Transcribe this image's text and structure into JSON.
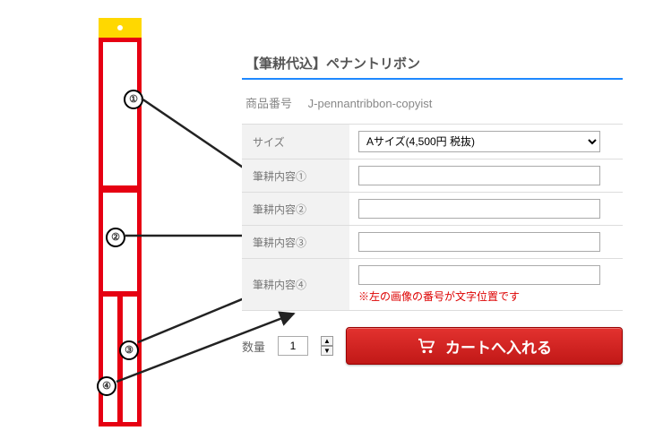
{
  "product": {
    "title": "【筆耕代込】ペナントリボン",
    "sku_label": "商品番号",
    "sku": "J-pennantribbon-copyist"
  },
  "options": {
    "size_label": "サイズ",
    "size_selected": "Aサイズ(4,500円 税抜)",
    "fields": [
      {
        "label": "筆耕内容①",
        "value": ""
      },
      {
        "label": "筆耕内容②",
        "value": ""
      },
      {
        "label": "筆耕内容③",
        "value": ""
      },
      {
        "label": "筆耕内容④",
        "value": ""
      }
    ],
    "note": "※左の画像の番号が文字位置です"
  },
  "purchase": {
    "qty_label": "数量",
    "qty": "1",
    "cart_label": "カートへ入れる"
  },
  "diagram": {
    "markers": [
      "①",
      "②",
      "③",
      "④"
    ]
  }
}
